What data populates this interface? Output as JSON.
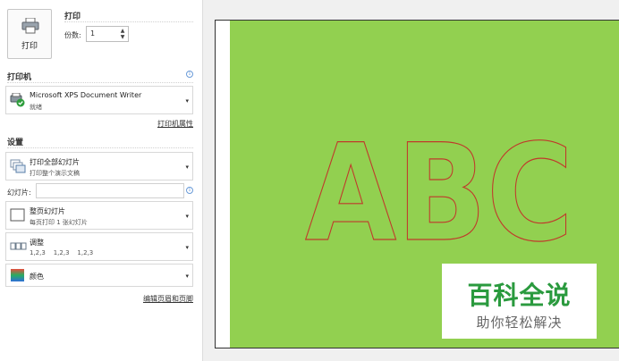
{
  "print": {
    "button_label": "打印",
    "title": "打印",
    "copies_label": "份数:",
    "copies_value": "1"
  },
  "printer": {
    "section_title": "打印机",
    "name": "Microsoft XPS Document Writer",
    "status": "就绪",
    "properties_link": "打印机属性"
  },
  "settings": {
    "section_title": "设置",
    "range_main": "打印全部幻灯片",
    "range_sub": "打印整个演示文稿",
    "slides_label": "幻灯片:",
    "slides_value": "",
    "layout_main": "整页幻灯片",
    "layout_sub": "每页打印 1 张幻灯片",
    "collate_main": "调整",
    "collate_sub": "1,2,3    1,2,3    1,2,3",
    "color_main": "颜色",
    "header_footer_link": "编辑页眉和页脚"
  },
  "preview": {
    "slide_text": "ABC",
    "slide_bg_color": "#92d050",
    "text_outline_color": "#c0392b"
  },
  "watermark": {
    "title": "百科全说",
    "subtitle": "助你轻松解决"
  }
}
